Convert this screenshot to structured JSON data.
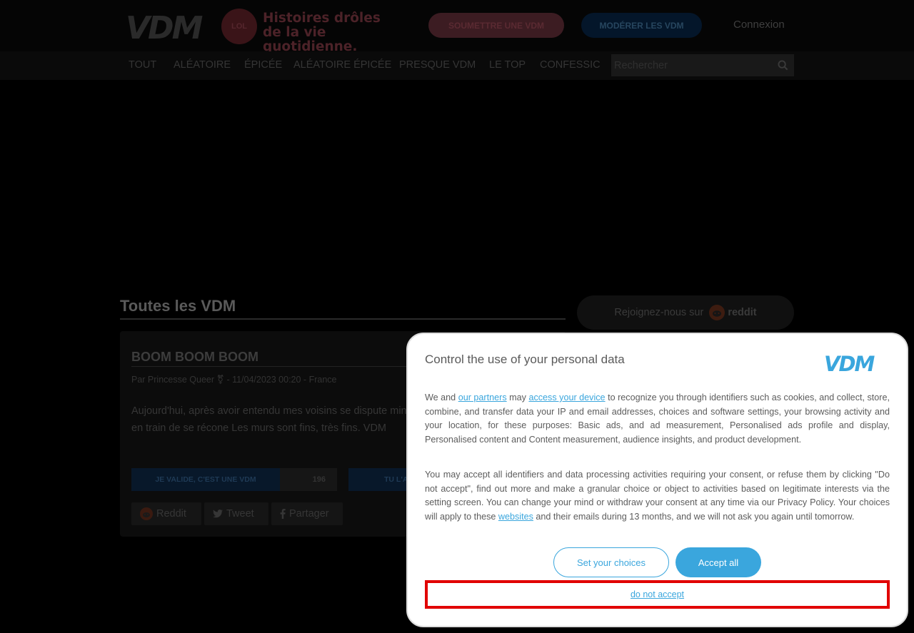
{
  "header": {
    "logo_text": "VDM",
    "logo_badge": "LOL",
    "tagline_line1": "Histoires drôles",
    "tagline_line2": "de la vie quotidienne.",
    "submit_label": "SOUMETTRE UNE VDM",
    "moderate_label": "MODÉRER LES VDM",
    "login_label": "Connexion"
  },
  "nav": {
    "items": [
      "TOUT",
      "ALÉATOIRE",
      "ÉPICÉE",
      "ALÉATOIRE ÉPICÉE",
      "PRESQUE VDM",
      "LE TOP",
      "CONFESSIC"
    ],
    "search_placeholder": "Rechercher",
    "search_icon": "search-icon"
  },
  "main": {
    "section_title": "Toutes les VDM",
    "post": {
      "title": "BOOM BOOM BOOM",
      "meta": "Par Princesse Queer ⚧ - 11/04/2023 00:20 - France",
      "body": "Aujourd'hui, après avoir entendu mes voisins se dispute minutes, je les entends désormais en train de se récone Les murs sont fins, très fins. VDM",
      "vote_valid_label": "JE VALIDE, C'EST UNE VDM",
      "vote_valid_count": "196",
      "vote_deserved_label": "TU L'A",
      "share_reddit": "Reddit",
      "share_tweet": "Tweet",
      "share_partager": "Partager"
    }
  },
  "sidebar": {
    "reddit_join": "Rejoignez-nous sur",
    "reddit_brand": "reddit"
  },
  "consent": {
    "title": "Control the use of your personal data",
    "brand": "VDM",
    "p1_pre": "We and ",
    "p1_link1": "our partners",
    "p1_mid": " may ",
    "p1_link2": "access your device",
    "p1_post": " to recognize you through identifiers such as cookies, and collect, store, combine, and transfer data your IP and email addresses, choices and software settings, your browsing activity and your location, for these purposes: Basic ads, and ad measurement, Personalised ads profile and display, Personalised content and Content measurement, audience insights, and product development.",
    "p2_pre": "You may accept all identifiers and data processing activities requiring your consent, or refuse them by clicking \"Do not accept\", find out more and make a granular choice or object to activities based on legitimate interests via the setting screen. You can change your mind or withdraw your consent at any time via our Privacy Policy. Your choices will apply to these ",
    "p2_link": "websites",
    "p2_post": " and their emails during 13 months, and we will not ask you again until tomorrow.",
    "btn_choices": "Set your choices",
    "btn_accept": "Accept all",
    "btn_reject": "do not accept"
  },
  "colors": {
    "accent": "#3aa6dd",
    "highlight": "#e10000"
  }
}
